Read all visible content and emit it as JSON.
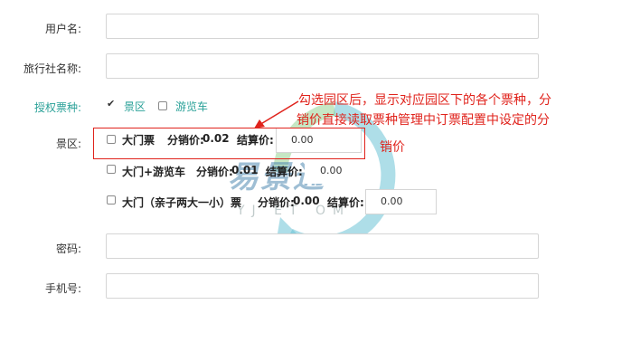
{
  "form": {
    "username_label": "用户名:",
    "agency_label": "旅行社名称:",
    "auth_label": "授权票种:",
    "auth_options": [
      {
        "label": "景区",
        "checked": true
      },
      {
        "label": "游览车",
        "checked": false
      }
    ],
    "scenic_label": "景区:",
    "tickets": [
      {
        "name": "大门票",
        "dist_label": "分销价:",
        "dist_price": "0.02",
        "settle_label": "结算价:",
        "settle_value": "0.00"
      },
      {
        "name": "大门+游览车",
        "dist_label": "分销价:",
        "dist_price": "0.01",
        "settle_label": "结算价:",
        "settle_value": "0.00"
      },
      {
        "name": "大门（亲子两大一小）票",
        "dist_label": "分销价:",
        "dist_price": "0.00",
        "settle_label": "结算价:",
        "settle_value": "0.00"
      }
    ],
    "password_label": "密码:",
    "phone_label": "手机号:"
  },
  "annotation": {
    "line1": "勾选园区后，显示对应园区下的各个票种，分",
    "line2": "销价直接读取票种管理中订票配置中设定的分",
    "line3": "销价"
  },
  "watermark": {
    "text": "易景通",
    "sub": "YJ ET OM"
  },
  "colors": {
    "accent": "#2aa198",
    "annotation": "#e0231c"
  }
}
